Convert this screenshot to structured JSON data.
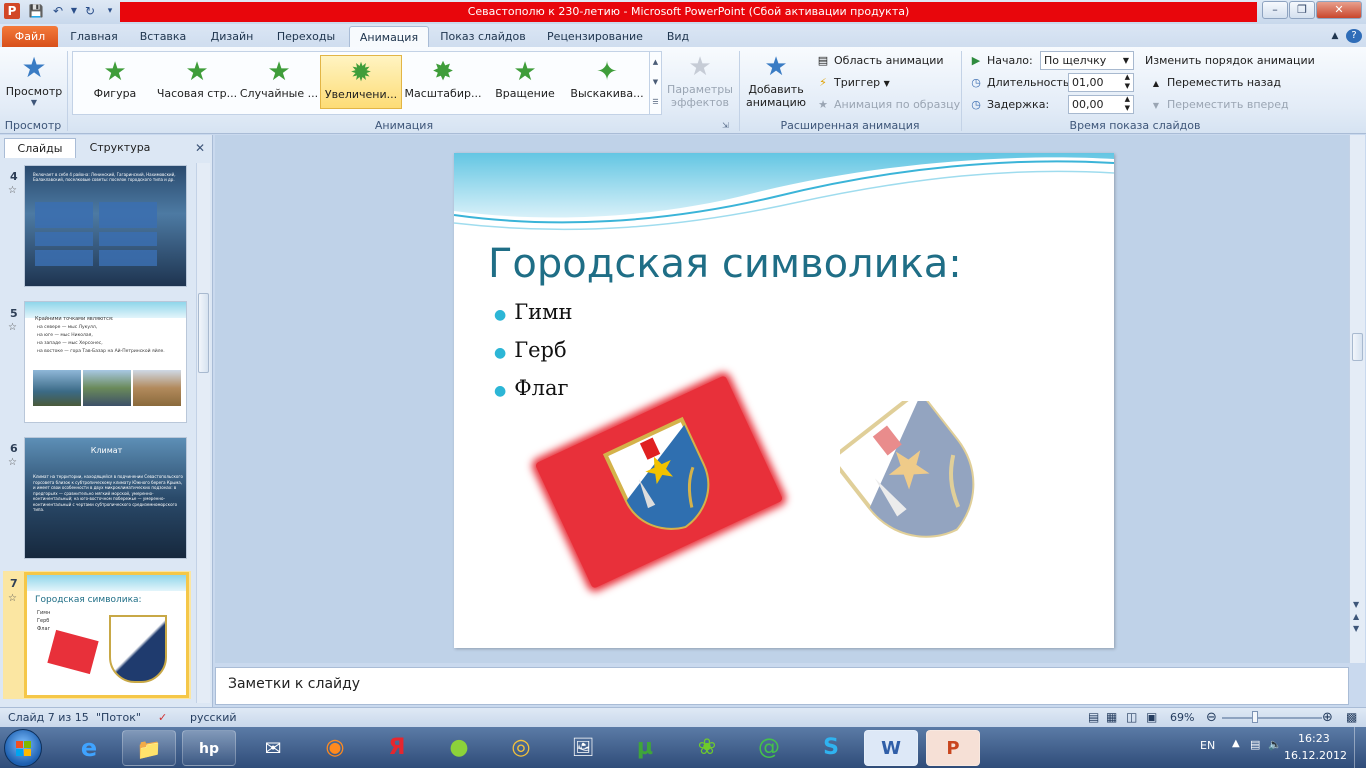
{
  "window": {
    "title": "Севастополю к 230-летию  -  Microsoft PowerPoint (Сбой активации продукта)"
  },
  "tabs": [
    {
      "label": "Файл"
    },
    {
      "label": "Главная"
    },
    {
      "label": "Вставка"
    },
    {
      "label": "Дизайн"
    },
    {
      "label": "Переходы"
    },
    {
      "label": "Анимация"
    },
    {
      "label": "Показ слайдов"
    },
    {
      "label": "Рецензирование"
    },
    {
      "label": "Вид"
    }
  ],
  "ribbon": {
    "preview": {
      "label": "Просмотр",
      "group": "Просмотр"
    },
    "animation_group": "Анимация",
    "animations": [
      {
        "label": "Фигура"
      },
      {
        "label": "Часовая стр..."
      },
      {
        "label": "Случайные ..."
      },
      {
        "label": "Увеличени..."
      },
      {
        "label": "Масштабир..."
      },
      {
        "label": "Вращение"
      },
      {
        "label": "Выскакива..."
      }
    ],
    "effect_options": {
      "line1": "Параметры",
      "line2": "эффектов"
    },
    "advanced": {
      "group": "Расширенная анимация",
      "add_line1": "Добавить",
      "add_line2": "анимацию",
      "pane": "Область анимации",
      "trigger": "Триггер",
      "painter": "Анимация по образцу"
    },
    "timing": {
      "group": "Время показа слайдов",
      "start_label": "Начало:",
      "start_value": "По щелчку",
      "duration_label": "Длительность:",
      "duration_value": "01,00",
      "delay_label": "Задержка:",
      "delay_value": "00,00",
      "reorder": "Изменить порядок анимации",
      "move_earlier": "Переместить назад",
      "move_later": "Переместить вперед"
    }
  },
  "panel": {
    "tab_slides": "Слайды",
    "tab_outline": "Структура",
    "slides": [
      {
        "num": "4",
        "text": "Включает в себя 4 района: Ленинский, Гагаринский, Нахимовский, Балаклавский, поселковые советы: поселок городского типа и др."
      },
      {
        "num": "5",
        "heading": "Крайними точками являются:",
        "bullets": [
          "на севере — мыс Лукулл,",
          "на юге — мыс Николая,",
          "на западе — мыс Херсонес,",
          "на востоке — гора Тав-Базар на Ай-Петринской яйле."
        ]
      },
      {
        "num": "6",
        "title": "Климат",
        "text": "Климат на территории, находящейся в подчинении Севастопольского горсовета близок к субтропическому климату Южного берега Крыма, и имеет свои особенности в двух микроклиматических подзонах: в предгорьях — сравнительно мягкий морской, умеренно-континентальный; на юго-восточном побережье — умеренно-континентальный с чертами субтропического средиземноморского типа."
      },
      {
        "num": "7",
        "title": "Городская символика:",
        "bullets": [
          "Гимн",
          "Герб",
          "Флаг"
        ]
      }
    ]
  },
  "slide": {
    "title": "Городская символика:",
    "bullets": [
      "Гимн",
      "Герб",
      "Флаг"
    ]
  },
  "notes": {
    "placeholder": "Заметки к слайду"
  },
  "status": {
    "slide_info": "Слайд 7 из 15",
    "theme": "\"Поток\"",
    "language": "русский",
    "zoom": "69%"
  },
  "taskbar": {
    "lang": "EN",
    "time": "16:23",
    "date": "16.12.2012"
  },
  "colors": {
    "accent_red": "#e8060c",
    "title_teal": "#1f6e86",
    "bullet_cyan": "#2cb6d6",
    "flag_red": "#e8303a"
  }
}
